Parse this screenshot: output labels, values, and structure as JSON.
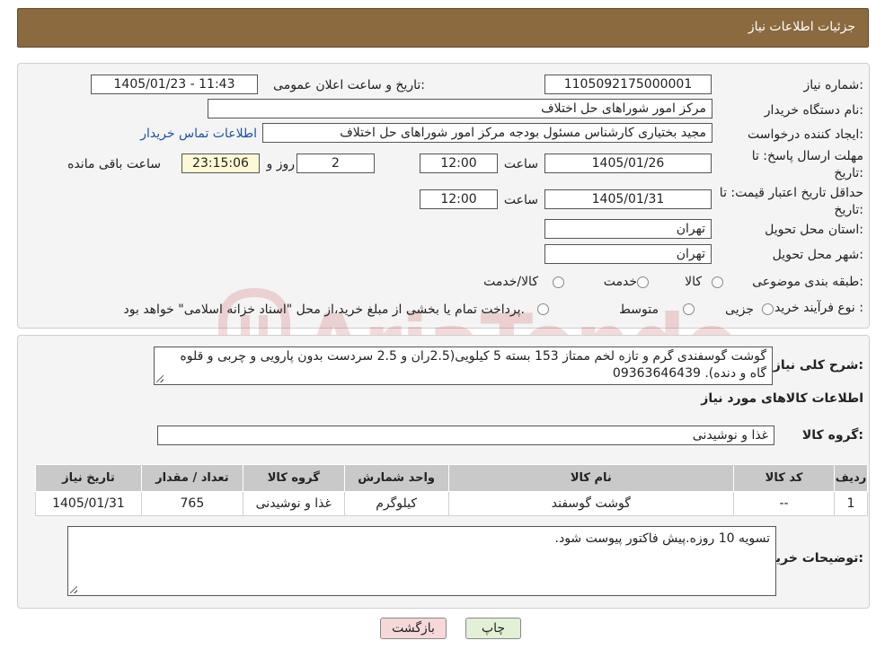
{
  "header": {
    "title": "جزئیات اطلاعات نیاز"
  },
  "fields": {
    "need_number_label": "شماره نیاز:",
    "need_number": "1105092175000001",
    "announce_label": "تاریخ و ساعت اعلان عمومی:",
    "announce_value": "1405/01/23 - 11:43",
    "buyer_org_label": "نام دستگاه خریدار:",
    "buyer_org": "مرکز امور شوراهای حل اختلاف",
    "creator_label": "ایجاد کننده درخواست:",
    "creator": "مجید بختیاری کارشناس مسئول بودجه مرکز امور شوراهای حل اختلاف",
    "contact_link": "اطلاعات تماس خریدار",
    "deadline_label": "مهلت ارسال پاسخ: تا تاریخ:",
    "deadline_date": "1405/01/26",
    "time_label": "ساعت",
    "deadline_time": "12:00",
    "days_value": "2",
    "days_label": "روز و",
    "remaining_time": "23:15:06",
    "remaining_label": "ساعت باقی مانده",
    "min_validity_label": "حداقل تاریخ اعتبار قیمت: تا تاریخ:",
    "min_validity_date": "1405/01/31",
    "min_validity_time": "12:00",
    "province_label": "استان محل تحویل:",
    "province": "تهران",
    "city_label": "شهر محل تحویل:",
    "city": "تهران",
    "category_label": "طبقه بندی موضوعی:",
    "category_options": [
      "کالا",
      "خدمت",
      "کالا/خدمت"
    ],
    "process_label": "نوع فرآیند خرید :",
    "process_options": [
      "جزیی",
      "متوسط"
    ],
    "process_note": "پرداخت تمام یا بخشی از مبلغ خرید،از محل \"اسناد خزانه اسلامی\" خواهد بود."
  },
  "summary": {
    "label": "شرح کلی نیاز:",
    "text": "گوشت گوسفندی گرم و تازه لخم ممتاز 153  بسته 5 کیلویی(2.5ران و 2.5 سردست بدون پارویی و چربی و قلوه گاه و دنده).  09363646439"
  },
  "goods_section": {
    "title": "اطلاعات کالاهای مورد نیاز",
    "group_label": "گروه کالا:",
    "group_value": "غذا و نوشیدنی"
  },
  "table": {
    "headers": [
      "ردیف",
      "کد کالا",
      "نام کالا",
      "واحد شمارش",
      "گروه کالا",
      "تعداد / مقدار",
      "تاریخ نیاز"
    ],
    "rows": [
      [
        "1",
        "--",
        "گوشت گوسفند",
        "کیلوگرم",
        "غذا و نوشیدنی",
        "765",
        "1405/01/31"
      ]
    ]
  },
  "buyer_notes": {
    "label": "توضیحات خریدار:",
    "text": "تسویه 10 روزه.پیش فاکتور پیوست شود."
  },
  "buttons": {
    "print": "چاپ",
    "back": "بازگشت"
  },
  "watermark_text": "AriaTender.neT",
  "colors": {
    "header_bg": "#8a6a3e",
    "link": "#1f4fa8",
    "back_btn": "#f7d8d8",
    "print_btn": "#e2f0d6"
  }
}
